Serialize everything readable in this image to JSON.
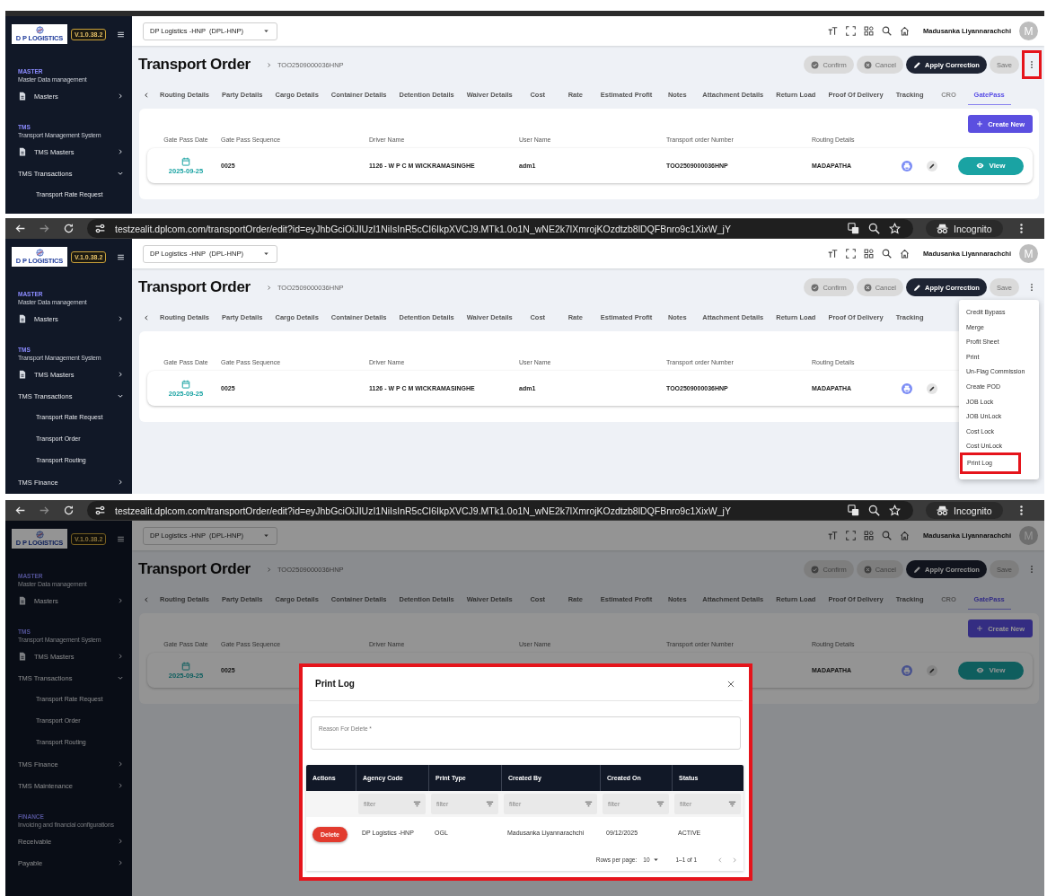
{
  "screens": [
    {
      "sidebar": {
        "logo_text": "D P LOGISTICS",
        "version": "V.1.0.38.2",
        "sections": [
          {
            "title": "MASTER",
            "subtitle": "Master Data management",
            "items": [
              {
                "label": "Masters",
                "kind": "module",
                "expanded": false
              }
            ]
          },
          {
            "title": "TMS",
            "subtitle": "Transport Management System",
            "items": [
              {
                "label": "TMS Masters",
                "kind": "module",
                "expanded": false
              },
              {
                "label": "TMS Transactions",
                "kind": "menu",
                "expanded": true,
                "children": [
                  {
                    "label": "Transport Rate Request"
                  }
                ]
              }
            ]
          }
        ]
      },
      "header": {
        "company": "DP Logistics -HNP  (DPL-HNP)",
        "user_name": "Madusanka Liyannarachchi",
        "avatar": "M"
      },
      "page": {
        "title": "Transport Order",
        "breadcrumb": "TOO2509000036HNP"
      },
      "actions": [
        {
          "label": "Confirm",
          "kind": "confirm",
          "disabled": true
        },
        {
          "label": "Cancel",
          "kind": "cancel",
          "disabled": true
        },
        {
          "label": "Apply Correction",
          "kind": "correction",
          "disabled": false
        },
        {
          "label": "Save",
          "kind": "save",
          "disabled": true
        }
      ],
      "more_button": {
        "highlighted": true
      },
      "tabs": [
        {
          "label": "Routing Details",
          "selected": false,
          "disabled": false
        },
        {
          "label": "Party Details",
          "selected": false,
          "disabled": false
        },
        {
          "label": "Cargo Details",
          "selected": false,
          "disabled": false
        },
        {
          "label": "Container Details",
          "selected": false,
          "disabled": false
        },
        {
          "label": "Detention Details",
          "selected": false,
          "disabled": false
        },
        {
          "label": "Waiver Details",
          "selected": false,
          "disabled": false
        },
        {
          "label": "Cost",
          "selected": false,
          "disabled": false
        },
        {
          "label": "Rate",
          "selected": false,
          "disabled": false
        },
        {
          "label": "Estimated Profit",
          "selected": false,
          "disabled": false
        },
        {
          "label": "Notes",
          "selected": false,
          "disabled": false
        },
        {
          "label": "Attachment Details",
          "selected": false,
          "disabled": false
        },
        {
          "label": "Return Load",
          "selected": false,
          "disabled": false
        },
        {
          "label": "Proof Of Delivery",
          "selected": false,
          "disabled": false
        },
        {
          "label": "Tracking",
          "selected": false,
          "disabled": false
        },
        {
          "label": "CRO",
          "selected": false,
          "disabled": true
        },
        {
          "label": "GatePass",
          "selected": true,
          "disabled": false
        }
      ],
      "create_button": {
        "label": "Create New"
      },
      "gate_pass_table": {
        "columns": [
          "Gate Pass Date",
          "Gate Pass Sequence",
          "Driver Name",
          "User Name",
          "Transport order Number",
          "Routing Details"
        ],
        "rows": [
          {
            "gate_pass_date": "2025-09-25",
            "gate_pass_sequence": "0025",
            "driver_name": "1126 - W P C M WICKRAMASINGHE",
            "user_name": "adm1",
            "transport_order_number": "TOO2509000036HNP",
            "routing_details": "MADAPATHA",
            "view": "View"
          }
        ]
      }
    },
    {
      "browser_bar": {
        "url": "testzealit.dplcom.com/transportOrder/edit?id=eyJhbGciOiJIUzI1NiIsInR5cCI6IkpXVCJ9.MTk1.0o1N_wNE2k7lXmrojKOzdtzb8lDQFBnro9c1XixW_jY",
        "profile": "Incognito"
      },
      "sidebar": {
        "logo_text": "D P LOGISTICS",
        "version": "V.1.0.38.2",
        "sections": [
          {
            "title": "MASTER",
            "subtitle": "Master Data management",
            "items": [
              {
                "label": "Masters",
                "kind": "module",
                "expanded": false
              }
            ]
          },
          {
            "title": "TMS",
            "subtitle": "Transport Management System",
            "items": [
              {
                "label": "TMS Masters",
                "kind": "module",
                "expanded": false
              },
              {
                "label": "TMS Transactions",
                "kind": "menu",
                "expanded": true,
                "children": [
                  {
                    "label": "Transport Rate Request"
                  },
                  {
                    "label": "Transport Order"
                  },
                  {
                    "label": "Transport Routing"
                  }
                ]
              },
              {
                "label": "TMS Finance",
                "kind": "menu",
                "expanded": false
              }
            ]
          }
        ]
      },
      "header": {
        "company": "DP Logistics -HNP  (DPL-HNP)",
        "user_name": "Madusanka Liyannarachchi",
        "avatar": "M"
      },
      "page": {
        "title": "Transport Order",
        "breadcrumb": "TOO2509000036HNP"
      },
      "actions": [
        {
          "label": "Confirm",
          "kind": "confirm",
          "disabled": true
        },
        {
          "label": "Cancel",
          "kind": "cancel",
          "disabled": true
        },
        {
          "label": "Apply Correction",
          "kind": "correction",
          "disabled": false
        },
        {
          "label": "Save",
          "kind": "save",
          "disabled": true
        }
      ],
      "more_button": {
        "highlighted": false
      },
      "tabs": [
        {
          "label": "Routing Details",
          "selected": false,
          "disabled": false
        },
        {
          "label": "Party Details",
          "selected": false,
          "disabled": false
        },
        {
          "label": "Cargo Details",
          "selected": false,
          "disabled": false
        },
        {
          "label": "Container Details",
          "selected": false,
          "disabled": false
        },
        {
          "label": "Detention Details",
          "selected": false,
          "disabled": false
        },
        {
          "label": "Waiver Details",
          "selected": false,
          "disabled": false
        },
        {
          "label": "Cost",
          "selected": false,
          "disabled": false
        },
        {
          "label": "Rate",
          "selected": false,
          "disabled": false
        },
        {
          "label": "Estimated Profit",
          "selected": false,
          "disabled": false
        },
        {
          "label": "Notes",
          "selected": false,
          "disabled": false
        },
        {
          "label": "Attachment Details",
          "selected": false,
          "disabled": false
        },
        {
          "label": "Return Load",
          "selected": false,
          "disabled": false
        },
        {
          "label": "Proof Of Delivery",
          "selected": false,
          "disabled": false
        },
        {
          "label": "Tracking",
          "selected": false,
          "disabled": false
        }
      ],
      "gate_pass_table": {
        "columns": [
          "Gate Pass Date",
          "Gate Pass Sequence",
          "Driver Name",
          "User Name",
          "Transport order Number",
          "Routing Details"
        ],
        "rows": [
          {
            "gate_pass_date": "2025-09-25",
            "gate_pass_sequence": "0025",
            "driver_name": "1126 - W P C M WICKRAMASINGHE",
            "user_name": "adm1",
            "transport_order_number": "TOO2509000036HNP",
            "routing_details": "MADAPATHA"
          }
        ]
      },
      "more_menu": {
        "items": [
          {
            "label": "Credit Bypass",
            "highlighted": false
          },
          {
            "label": "Merge",
            "highlighted": false
          },
          {
            "label": "Profit Sheet",
            "highlighted": false
          },
          {
            "label": "Print",
            "highlighted": false
          },
          {
            "label": "Un-Flag Commission",
            "highlighted": false
          },
          {
            "label": "Create POD",
            "highlighted": false
          },
          {
            "label": "JOB Lock",
            "highlighted": false
          },
          {
            "label": "JOB UnLock",
            "highlighted": false
          },
          {
            "label": "Cost Lock",
            "highlighted": false
          },
          {
            "label": "Cost UnLock",
            "highlighted": false
          },
          {
            "label": "Print Log",
            "highlighted": true
          }
        ]
      }
    },
    {
      "browser_bar": {
        "url": "testzealit.dplcom.com/transportOrder/edit?id=eyJhbGciOiJIUzI1NiIsInR5cCI6IkpXVCJ9.MTk1.0o1N_wNE2k7lXmrojKOzdtzb8lDQFBnro9c1XixW_jY",
        "profile": "Incognito"
      },
      "sidebar": {
        "logo_text": "D P LOGISTICS",
        "version": "V.1.0.38.2",
        "sections": [
          {
            "title": "MASTER",
            "subtitle": "Master Data management",
            "items": [
              {
                "label": "Masters",
                "kind": "module",
                "expanded": false
              }
            ]
          },
          {
            "title": "TMS",
            "subtitle": "Transport Management System",
            "items": [
              {
                "label": "TMS Masters",
                "kind": "module",
                "expanded": false
              },
              {
                "label": "TMS Transactions",
                "kind": "menu",
                "expanded": true,
                "children": [
                  {
                    "label": "Transport Rate Request"
                  },
                  {
                    "label": "Transport Order"
                  },
                  {
                    "label": "Transport Routing"
                  }
                ]
              },
              {
                "label": "TMS Finance",
                "kind": "menu",
                "expanded": false
              },
              {
                "label": "TMS Maintenance",
                "kind": "menu",
                "expanded": false
              }
            ]
          },
          {
            "title": "FINANCE",
            "subtitle": "Invoicing and financial configurations",
            "items": [
              {
                "label": "Receivable",
                "kind": "menu",
                "expanded": false
              },
              {
                "label": "Payable",
                "kind": "menu",
                "expanded": false
              }
            ]
          }
        ]
      },
      "header": {
        "company": "DP Logistics -HNP  (DPL-HNP)",
        "user_name": "Madusanka Liyannarachchi",
        "avatar": "M"
      },
      "page": {
        "title": "Transport Order",
        "breadcrumb": "TOO2509000036HNP"
      },
      "actions": [
        {
          "label": "Confirm",
          "kind": "confirm",
          "disabled": true
        },
        {
          "label": "Cancel",
          "kind": "cancel",
          "disabled": true
        },
        {
          "label": "Apply Correction",
          "kind": "correction",
          "disabled": false
        },
        {
          "label": "Save",
          "kind": "save",
          "disabled": true
        }
      ],
      "more_button": {
        "highlighted": false
      },
      "tabs": [
        {
          "label": "Routing Details",
          "selected": false,
          "disabled": false
        },
        {
          "label": "Party Details",
          "selected": false,
          "disabled": false
        },
        {
          "label": "Cargo Details",
          "selected": false,
          "disabled": false
        },
        {
          "label": "Container Details",
          "selected": false,
          "disabled": false
        },
        {
          "label": "Detention Details",
          "selected": false,
          "disabled": false
        },
        {
          "label": "Waiver Details",
          "selected": false,
          "disabled": false
        },
        {
          "label": "Cost",
          "selected": false,
          "disabled": false
        },
        {
          "label": "Rate",
          "selected": false,
          "disabled": false
        },
        {
          "label": "Estimated Profit",
          "selected": false,
          "disabled": false
        },
        {
          "label": "Notes",
          "selected": false,
          "disabled": false
        },
        {
          "label": "Attachment Details",
          "selected": false,
          "disabled": false
        },
        {
          "label": "Return Load",
          "selected": false,
          "disabled": false
        },
        {
          "label": "Proof Of Delivery",
          "selected": false,
          "disabled": false
        },
        {
          "label": "Tracking",
          "selected": false,
          "disabled": false
        },
        {
          "label": "CRO",
          "selected": false,
          "disabled": true
        },
        {
          "label": "GatePass",
          "selected": true,
          "disabled": false
        }
      ],
      "create_button": {
        "label": "Create New"
      },
      "gate_pass_table": {
        "columns": [
          "Gate Pass Date",
          "Gate Pass Sequence",
          "Driver Name",
          "User Name",
          "Transport order Number",
          "Routing Details"
        ],
        "rows": [
          {
            "gate_pass_date": "2025-09-25",
            "gate_pass_sequence": "0025",
            "routing_details": "MADAPATHA",
            "view": "View"
          }
        ]
      },
      "modal": {
        "title": "Print Log",
        "highlighted": true,
        "reason_field": {
          "placeholder": "Reason For Delete *"
        },
        "table": {
          "columns": [
            {
              "label": "Actions"
            },
            {
              "label": "Agency Code",
              "filter": {
                "placeholder": "filter"
              }
            },
            {
              "label": "Print Type",
              "filter": {
                "placeholder": "filter"
              }
            },
            {
              "label": "Created By",
              "filter": {
                "placeholder": "filter"
              }
            },
            {
              "label": "Created On",
              "filter": {
                "placeholder": "filter"
              }
            },
            {
              "label": "Status",
              "filter": {
                "placeholder": "filter"
              }
            }
          ],
          "rows": [
            {
              "cells": [
                "Delete",
                "DP Logistics -HNP",
                "OGL",
                "Madusanka Liyannarachchi",
                "09/12/2025",
                "ACTIVE"
              ]
            }
          ]
        },
        "pagination": {
          "rows_per_page_label": "Rows per page:",
          "rows_per_page": "10",
          "range": "1–1 of 1"
        }
      }
    }
  ]
}
